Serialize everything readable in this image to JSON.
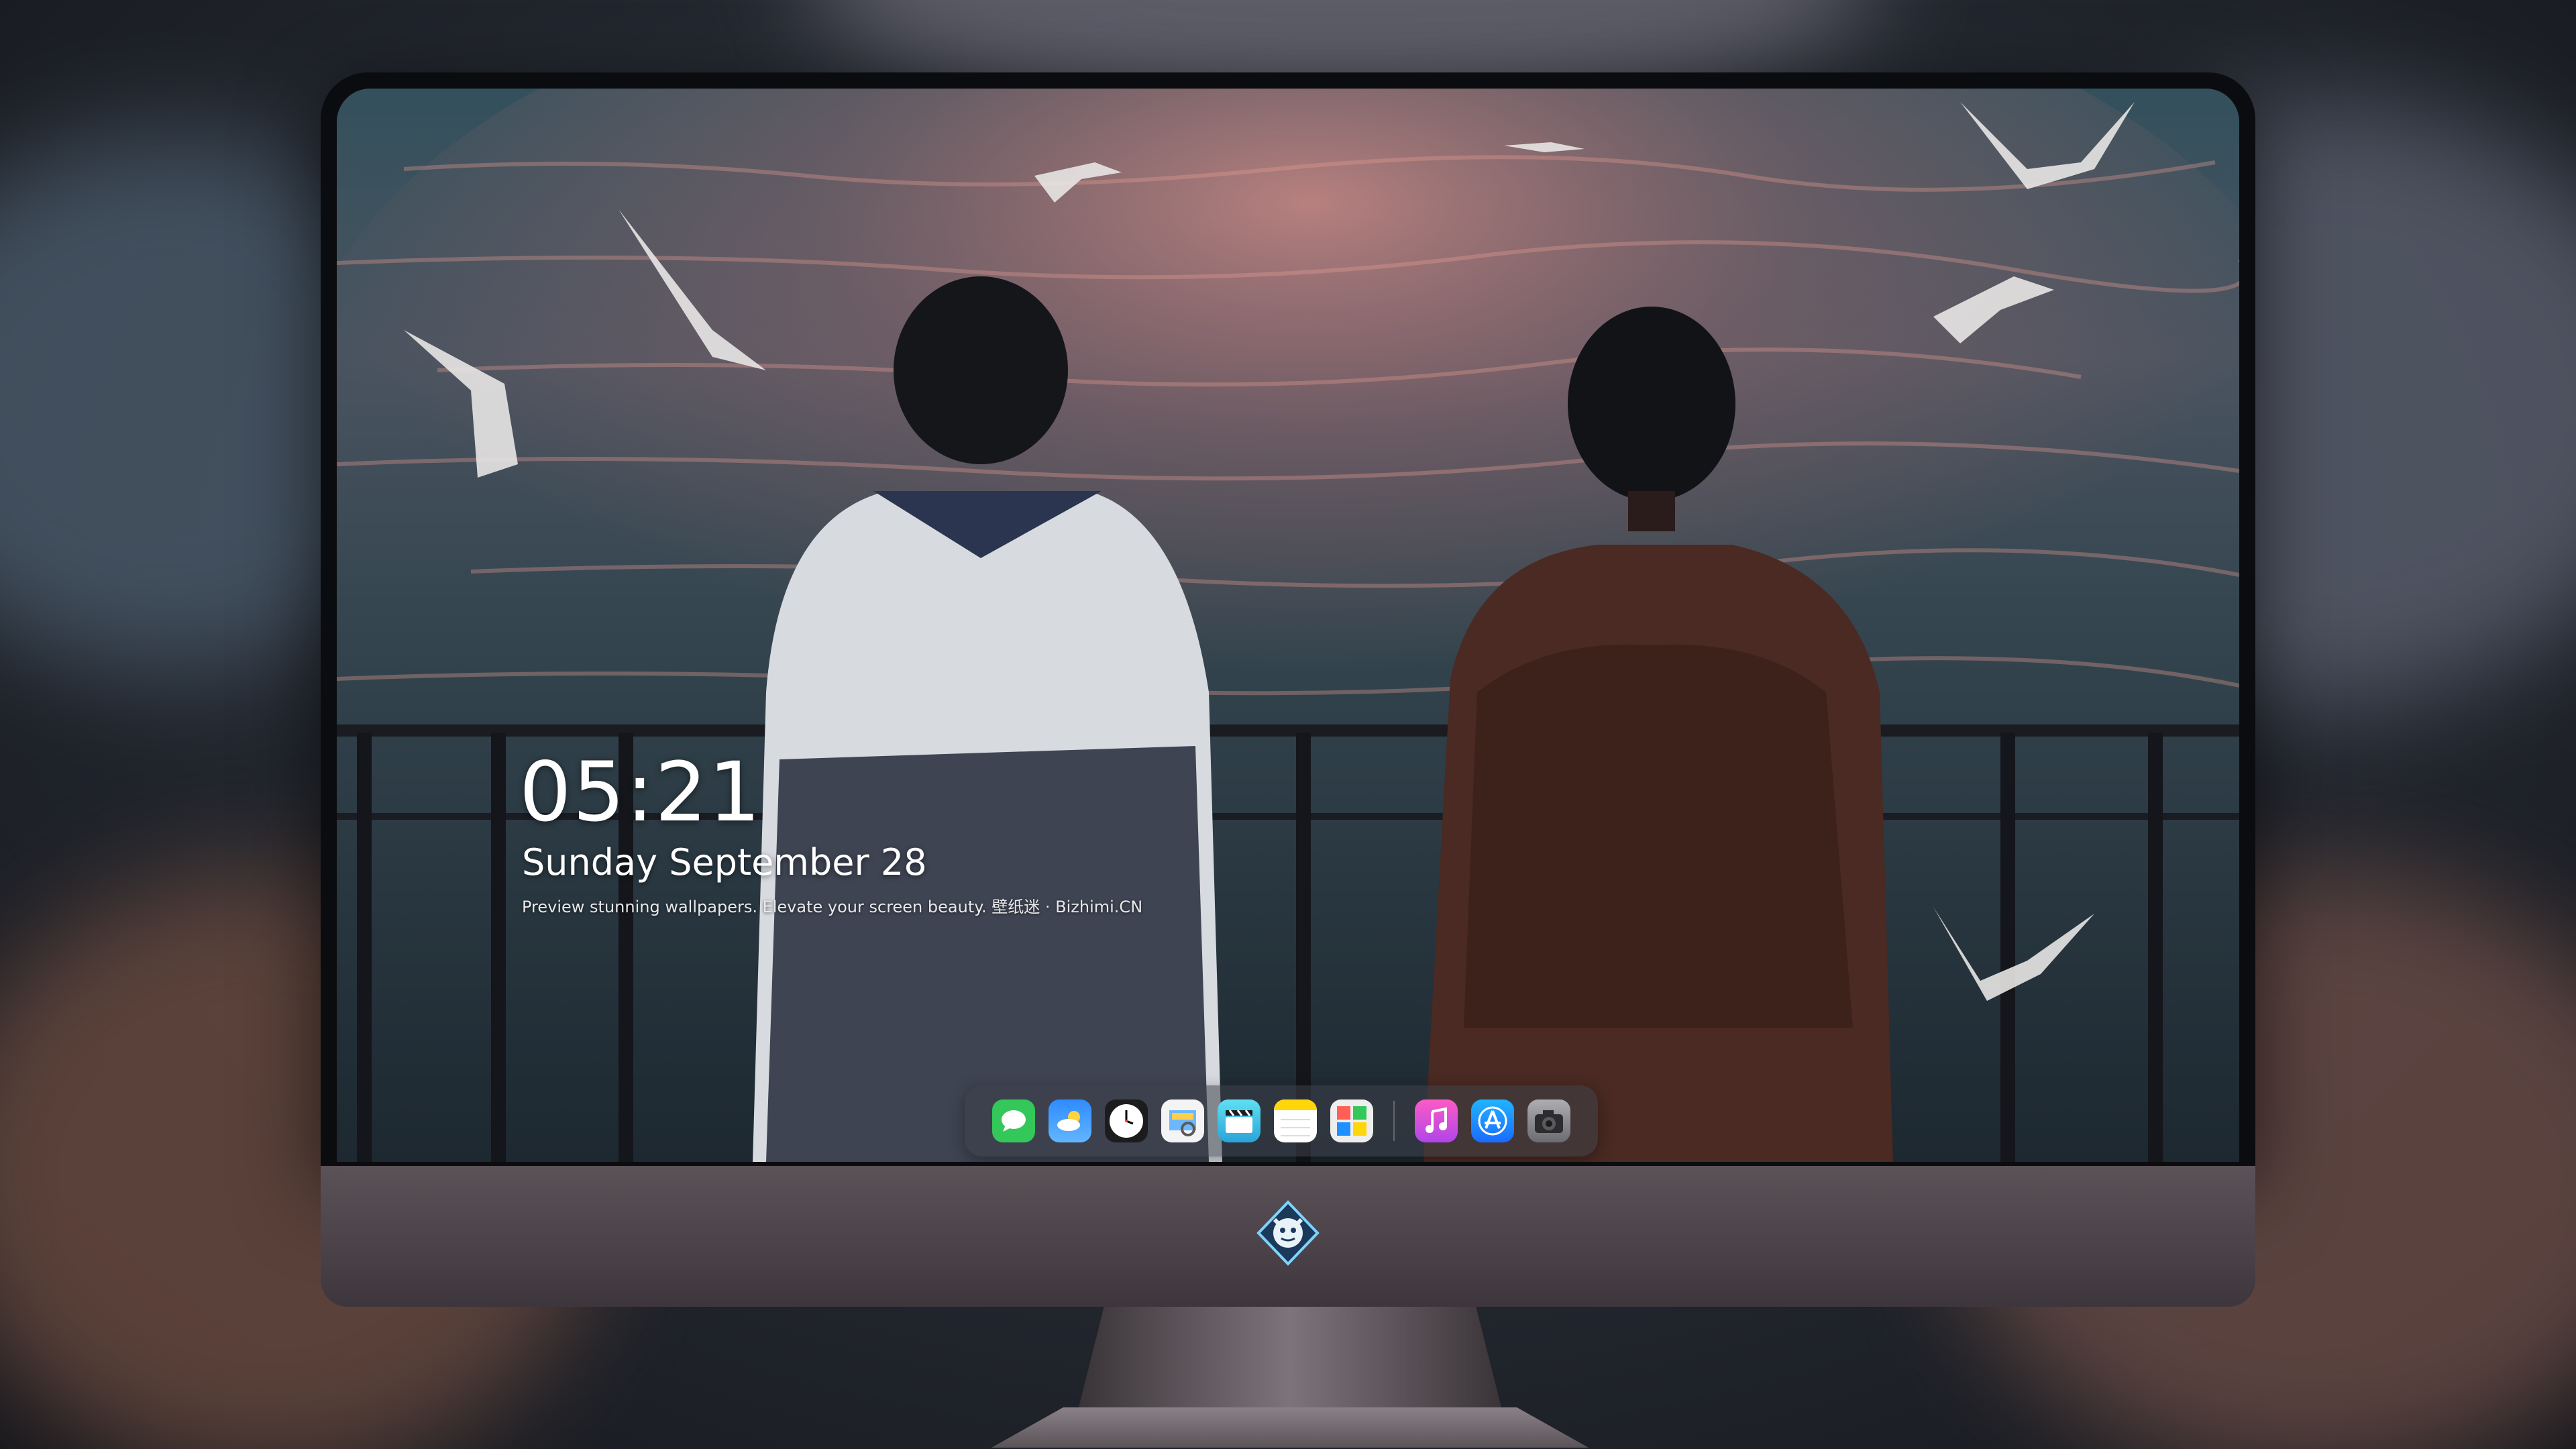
{
  "lock_screen": {
    "time": "05:21",
    "date": "Sunday September  28",
    "tagline": "Preview stunning wallpapers. Elevate your screen beauty. 壁纸迷 · Bizhimi.CN"
  },
  "dock": {
    "apps": [
      {
        "icon": "messages-icon",
        "color": "#34c759"
      },
      {
        "icon": "weather-icon",
        "color": "#1e90ff"
      },
      {
        "icon": "clock-icon",
        "color": "#ffffff"
      },
      {
        "icon": "preview-icon",
        "color": "#f2c94c"
      },
      {
        "icon": "clips-icon",
        "color": "#4fd1e5"
      },
      {
        "icon": "notes-icon",
        "color": "#ffd60a"
      },
      {
        "icon": "photo-booth-icon",
        "color": "#e6e6e6"
      },
      {
        "icon": "music-icon",
        "color": "#e04dd3"
      },
      {
        "icon": "app-store-icon",
        "color": "#1f8bff"
      },
      {
        "icon": "camera-icon",
        "color": "#8e8e93"
      }
    ]
  },
  "monitor": {
    "logo_icon": "brand-mascot-icon"
  }
}
